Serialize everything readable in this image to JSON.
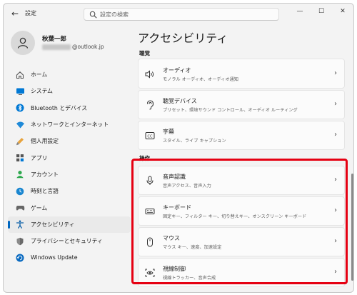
{
  "window": {
    "app_title": "設定",
    "back_label": "←",
    "search_placeholder": "設定の検索",
    "controls": {
      "minimize": "—",
      "maximize": "☐",
      "close": "✕"
    }
  },
  "user": {
    "name": "秋葉一郎",
    "email_suffix": "@outlook.jp"
  },
  "sidebar": {
    "items": [
      {
        "label": "ホーム",
        "icon": "home-icon"
      },
      {
        "label": "システム",
        "icon": "system-icon"
      },
      {
        "label": "Bluetooth とデバイス",
        "icon": "bluetooth-icon"
      },
      {
        "label": "ネットワークとインターネット",
        "icon": "network-icon"
      },
      {
        "label": "個人用設定",
        "icon": "personalization-icon"
      },
      {
        "label": "アプリ",
        "icon": "apps-icon"
      },
      {
        "label": "アカウント",
        "icon": "accounts-icon"
      },
      {
        "label": "時刻と言語",
        "icon": "time-language-icon"
      },
      {
        "label": "ゲーム",
        "icon": "gaming-icon"
      },
      {
        "label": "アクセシビリティ",
        "icon": "accessibility-icon",
        "active": true
      },
      {
        "label": "プライバシーとセキュリティ",
        "icon": "privacy-shield-icon"
      },
      {
        "label": "Windows Update",
        "icon": "windows-update-icon"
      }
    ]
  },
  "main": {
    "title": "アクセシビリティ",
    "sections": [
      {
        "label": "聴覚",
        "cards": [
          {
            "title": "オーディオ",
            "desc": "モノラル オーディオ、オーディオ通知",
            "icon": "speaker-icon"
          },
          {
            "title": "聴覚デバイス",
            "desc": "プリセット、環境サウンド コントロール、オーディオ ルーティング",
            "icon": "hearing-device-icon"
          },
          {
            "title": "字幕",
            "desc": "スタイル、ライブ キャプション",
            "icon": "captions-icon"
          }
        ]
      },
      {
        "label": "操作",
        "cards": [
          {
            "title": "音声認識",
            "desc": "音声アクセス、音声入力",
            "icon": "microphone-icon"
          },
          {
            "title": "キーボード",
            "desc": "固定キー、フィルター キー、切り替えキー、オンスクリーン キーボード",
            "icon": "keyboard-icon"
          },
          {
            "title": "マウス",
            "desc": "マウス キー、速度、加速設定",
            "icon": "mouse-icon"
          },
          {
            "title": "視線制御",
            "desc": "視線トラッカー、音声合成",
            "icon": "eye-control-icon"
          }
        ]
      }
    ]
  },
  "colors": {
    "accent": "#0067c0",
    "highlight_border": "#e50012",
    "window_bg": "#f3f3f3",
    "card_bg": "#fbfbfb"
  }
}
